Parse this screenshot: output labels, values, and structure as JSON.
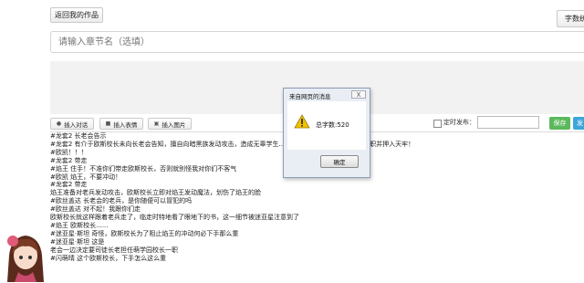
{
  "toolbar": {
    "back_label": "返回我的作品",
    "wordcount_label": "字数统"
  },
  "title_input": {
    "placeholder": "请输入章节名（选填）"
  },
  "insert": {
    "dialogue": "插入对话",
    "emoji": "插入表情",
    "image": "插入图片"
  },
  "schedule": {
    "label": "定时发布：",
    "save": "保存",
    "publish": "发"
  },
  "content_lines": [
    "#龙套2 长老会告示",
    "#龙套2 有介于欧斯校长未向长老会告知，擅自向暗黑族发动攻击，造成无辜学生...      ...撤离欧斯长老萌学园校长一职并押入天牢！",
    "#欧凯！！！",
    "#龙套2 带走",
    "#焰王 住手！不准你们带走欧斯校长，否则就别怪我对你们不客气",
    "#欧凯 焰王，不要冲动！",
    "#龙套2 带走",
    "焰王准备对老兵发动攻击，欧斯校长立即对焰王发动魔法，划伤了焰王的脸",
    "#欧丝盖达 长老会的老兵，是你随便可以冒犯的吗",
    "#欧丝盖达 对不起！我跟你们走",
    "欧斯校长就这样跟着老兵走了，临走时特地看了眼地下的书，这一细节被迷亚星注意到了",
    "#焰王 欧斯校长......",
    "#迷亚星·斯坦 奇怪，欧斯校长为了阻止焰王的冲动何必下手那么重",
    "#迷亚星·斯坦 这是",
    "老会一边决定要司徒长老担任萌学园校长一职",
    "#闪萌晴 这个欧斯校长，下手怎么这么重"
  ],
  "dialog": {
    "title": "来自网页的消息",
    "close": "X",
    "message": "总字数:520",
    "ok": "确定"
  },
  "colors": {
    "save": "#5cb85c",
    "publish": "#3ca6d8",
    "dialog_bg": "#e9eef5"
  }
}
